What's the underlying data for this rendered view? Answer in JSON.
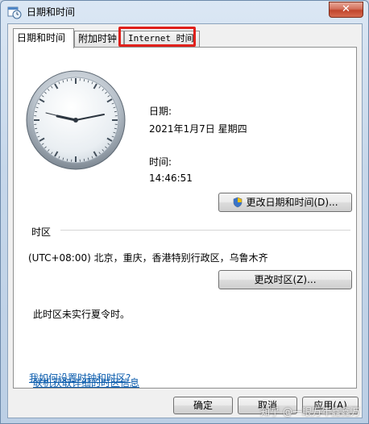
{
  "window": {
    "title": "日期和时间",
    "close_label": "✕"
  },
  "tabs": [
    {
      "label": "日期和时间",
      "active": true
    },
    {
      "label": "附加时钟",
      "active": false
    },
    {
      "label": "Internet 时间",
      "active": false
    }
  ],
  "datetime": {
    "date_label": "日期:",
    "date_value": "2021年1月7日 星期四",
    "time_label": "时间:",
    "time_value": "14:46:51",
    "change_button": "更改日期和时间(D)..."
  },
  "timezone": {
    "section_label": "时区",
    "value": "(UTC+08:00) 北京，重庆，香港特别行政区，乌鲁木齐",
    "change_button": "更改时区(Z)...",
    "dst_note": "此时区未实行夏令时。"
  },
  "links": {
    "online_info": "联机获取详细的时区信息",
    "how_to": "我如何设置时钟和时区?"
  },
  "footer": {
    "ok": "确定",
    "cancel": "取消",
    "apply": "应用(A)"
  },
  "watermark": "知乎 @一眼万年鑫鑫万"
}
